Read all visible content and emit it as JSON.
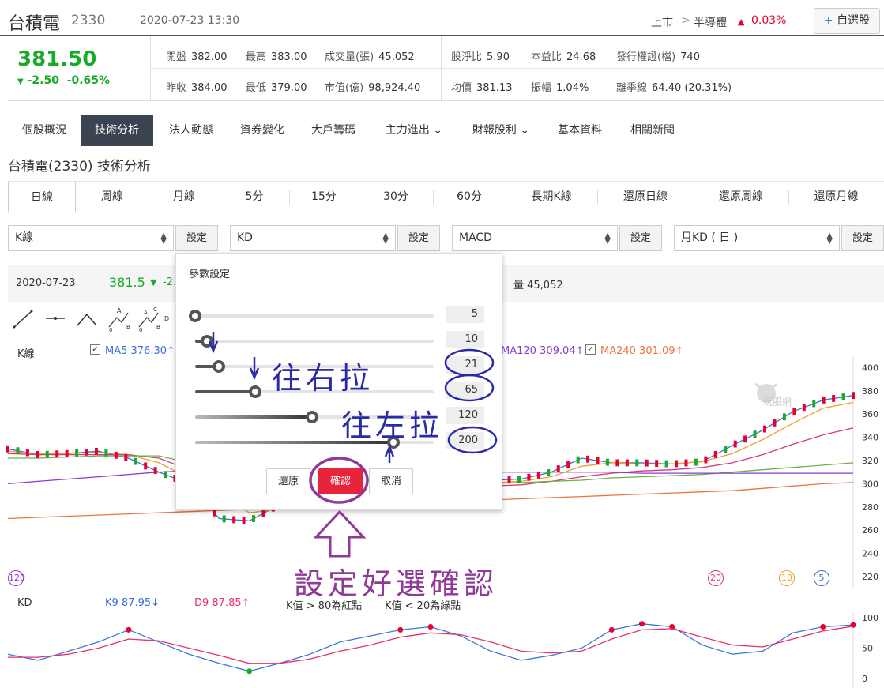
{
  "header": {
    "name": "台積電",
    "code": "2330",
    "datetime": "2020-07-23 13:30",
    "market": "上市",
    "chevron": ">",
    "industry": "半導體",
    "change_pct": "0.03%",
    "watch_label": "自選股"
  },
  "quote": {
    "price": "381.50",
    "change": "-2.50",
    "change_pct": "-0.65%",
    "items": [
      {
        "label": "開盤",
        "value": "382.00"
      },
      {
        "label": "最高",
        "value": "383.00"
      },
      {
        "label": "成交量(張)",
        "value": "45,052"
      },
      {
        "label": "股淨比",
        "value": "5.90"
      },
      {
        "label": "本益比",
        "value": "24.68"
      },
      {
        "label": "發行權證(檔)",
        "value": "740"
      },
      {
        "label": "昨收",
        "value": "384.00"
      },
      {
        "label": "最低",
        "value": "379.00"
      },
      {
        "label": "市值(億)",
        "value": "98,924.40"
      },
      {
        "label": "均價",
        "value": "381.13"
      },
      {
        "label": "振幅",
        "value": "1.04%"
      },
      {
        "label": "離季線",
        "value": "64.40 (20.31%)"
      }
    ]
  },
  "main_tabs": [
    "個股概況",
    "技術分析",
    "法人動態",
    "資券變化",
    "大戶籌碼",
    "主力進出",
    "財報股利",
    "基本資料",
    "相關新聞"
  ],
  "page_title": "台積電(2330) 技術分析",
  "period_tabs": [
    "日線",
    "周線",
    "月線",
    "5分",
    "15分",
    "30分",
    "60分",
    "長期K線",
    "還原日線",
    "還原周線",
    "還原月線"
  ],
  "selectors": [
    {
      "value": "K線",
      "btn": "設定"
    },
    {
      "value": "KD",
      "btn": "設定"
    },
    {
      "value": "MACD",
      "btn": "設定"
    },
    {
      "value": "月KD ( 日 )",
      "btn": "設定"
    }
  ],
  "chart_bar": {
    "date": "2020-07-23",
    "price": "381.5",
    "change": "-2.",
    "volume": "量 45,052"
  },
  "legend": {
    "k_label": "K線",
    "ma5": "MA5 376.30↑",
    "ma120": "MA120 309.04↑",
    "ma240": "MA240 301.09↑"
  },
  "kd_legend": {
    "label": "KD",
    "k9": "K9 87.95↓",
    "d9": "D9 87.85↑",
    "note_hi": "K值 > 80為紅點",
    "note_lo": "K值 < 20為綠點"
  },
  "popup": {
    "title": "參數設定",
    "values": [
      "5",
      "10",
      "21",
      "65",
      "120",
      "200"
    ],
    "fractions": [
      0.0,
      0.05,
      0.1,
      0.25,
      0.49,
      0.83
    ],
    "reset": "還原",
    "confirm": "確認",
    "cancel": "取消"
  },
  "annotations": {
    "right": "往右拉",
    "left": "往左拉",
    "confirm_note": "設定好選確認"
  },
  "watermark": "玩股網",
  "ma_badges": {
    "b120": "120",
    "b20": "20",
    "b10": "10",
    "b5": "5"
  },
  "colors": {
    "up": "#e8002e",
    "down": "#1aaa2a",
    "ma5": "#3a6fd8",
    "ma10": "#f0a030",
    "ma20": "#d83a7a",
    "ma60": "#6ab04c",
    "ma120": "#8a3ad0",
    "ma240": "#f07040",
    "kline": "#3a7ad8",
    "dline": "#e8306a",
    "annot_blue": "#2a2aa8",
    "annot_purple": "#8e3a96"
  },
  "chart_data": {
    "type": "line",
    "title": "",
    "y_ticks": [
      "400",
      "380",
      "360",
      "340",
      "320",
      "300",
      "280",
      "260",
      "240",
      "220"
    ],
    "kd_ticks": [
      "100",
      "50",
      "0"
    ],
    "ylim": [
      220,
      405
    ],
    "kd_ylim": [
      0,
      100
    ],
    "series": [
      {
        "name": "MA5",
        "values": [
          330,
          325,
          326,
          328,
          322,
          310,
          300,
          270,
          268,
          282,
          292,
          292,
          290,
          300,
          302,
          303,
          303,
          304,
          310,
          322,
          318,
          318,
          317,
          319,
          333,
          346,
          362,
          372,
          376
        ]
      },
      {
        "name": "MA10",
        "values": [
          328,
          326,
          326,
          327,
          325,
          318,
          305,
          290,
          275,
          278,
          285,
          288,
          288,
          296,
          298,
          300,
          301,
          302,
          306,
          315,
          318,
          317,
          317,
          319,
          326,
          338,
          352,
          365,
          370
        ]
      },
      {
        "name": "MA20",
        "values": [
          326,
          325,
          325,
          325,
          325,
          322,
          312,
          300,
          290,
          285,
          285,
          287,
          288,
          292,
          294,
          296,
          298,
          299,
          302,
          306,
          309,
          311,
          312,
          314,
          318,
          325,
          334,
          342,
          348
        ]
      },
      {
        "name": "MA60",
        "values": [
          322,
          322,
          323,
          324,
          324,
          324,
          318,
          312,
          306,
          302,
          300,
          300,
          300,
          300,
          300,
          300,
          300,
          301,
          302,
          303,
          305,
          306,
          307,
          308,
          310,
          312,
          314,
          316,
          318
        ]
      },
      {
        "name": "MA120",
        "values": [
          300,
          302,
          304,
          306,
          308,
          310,
          311,
          312,
          312,
          312,
          312,
          312,
          312,
          311,
          311,
          310,
          310,
          310,
          310,
          310,
          310,
          309,
          309,
          309,
          309,
          309,
          309,
          309,
          309
        ]
      },
      {
        "name": "MA240",
        "values": [
          270,
          271,
          272,
          273,
          274,
          275,
          276,
          277,
          278,
          279,
          280,
          281,
          282,
          283,
          284,
          285,
          286,
          287,
          288,
          289,
          290,
          291,
          292,
          293,
          294,
          296,
          298,
          300,
          301
        ]
      },
      {
        "name": "K9",
        "values": [
          40,
          30,
          45,
          60,
          80,
          60,
          40,
          25,
          12,
          25,
          40,
          60,
          70,
          80,
          85,
          70,
          45,
          30,
          38,
          50,
          80,
          90,
          85,
          55,
          40,
          45,
          75,
          85,
          88
        ]
      },
      {
        "name": "D9",
        "values": [
          35,
          35,
          40,
          50,
          65,
          62,
          50,
          38,
          25,
          25,
          32,
          45,
          55,
          68,
          75,
          72,
          60,
          45,
          42,
          45,
          65,
          80,
          82,
          68,
          55,
          52,
          65,
          78,
          86
        ]
      }
    ]
  }
}
